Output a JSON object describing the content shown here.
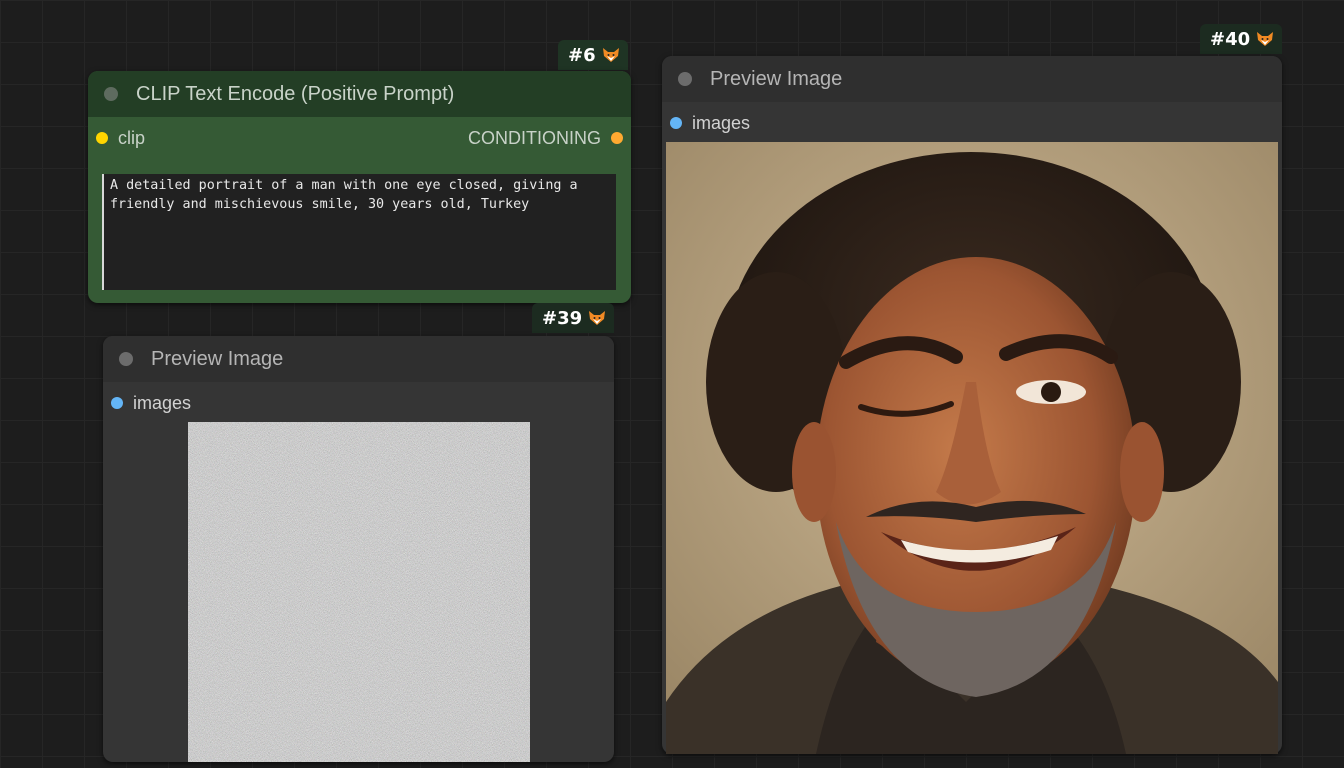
{
  "nodes": {
    "clip": {
      "id_label": "#6",
      "title": "CLIP Text Encode (Positive Prompt)",
      "input_label": "clip",
      "output_label": "CONDITIONING",
      "prompt_text": "A detailed portrait of a man with one eye closed, giving a friendly and mischievous smile, 30 years old, Turkey",
      "input_color": "#ffd500",
      "output_color": "#ffa931"
    },
    "preview_small": {
      "id_label": "#39",
      "title": "Preview Image",
      "input_label": "images",
      "input_color": "#64b5f6",
      "image_icon": "noise-image"
    },
    "preview_large": {
      "id_label": "#40",
      "title": "Preview Image",
      "input_label": "images",
      "input_color": "#64b5f6",
      "image_icon": "portrait-photo"
    }
  },
  "icons": {
    "badge": "fox-icon"
  }
}
